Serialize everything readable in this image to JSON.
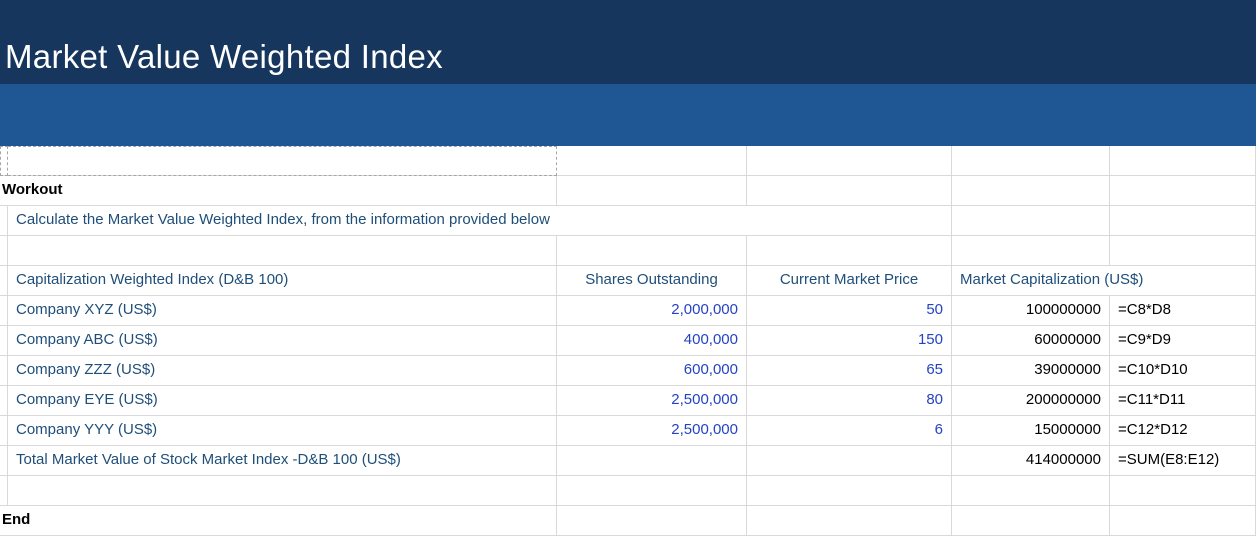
{
  "header": {
    "title": "Market Value Weighted Index"
  },
  "workout": {
    "label": "Workout",
    "instruction": "Calculate the Market Value Weighted Index, from the information provided below"
  },
  "table": {
    "col_b_header": "Capitalization Weighted Index (D&B 100)",
    "col_c_header": "Shares Outstanding",
    "col_d_header": "Current Market Price",
    "col_e_header": "Market Capitalization (US$)",
    "rows": [
      {
        "label": "Company XYZ (US$)",
        "shares": "2,000,000",
        "price": "50",
        "market_cap": "100000000",
        "formula": "=C8*D8"
      },
      {
        "label": "Company ABC (US$)",
        "shares": "400,000",
        "price": "150",
        "market_cap": "60000000",
        "formula": "=C9*D9"
      },
      {
        "label": "Company ZZZ (US$)",
        "shares": "600,000",
        "price": "65",
        "market_cap": "39000000",
        "formula": "=C10*D10"
      },
      {
        "label": "Company EYE (US$)",
        "shares": "2,500,000",
        "price": "80",
        "market_cap": "200000000",
        "formula": "=C11*D11"
      },
      {
        "label": "Company YYY (US$)",
        "shares": "2,500,000",
        "price": "6",
        "market_cap": "15000000",
        "formula": "=C12*D12"
      }
    ],
    "total": {
      "label": "Total Market Value of Stock Market Index -D&B 100 (US$)",
      "market_cap": "414000000",
      "formula": "=SUM(E8:E12)"
    }
  },
  "footer": {
    "end_label": "End"
  },
  "colors": {
    "banner_dark": "#17365D",
    "banner_light": "#1F5795",
    "label_blue": "#1F4E79",
    "value_blue": "#2443C4",
    "gridline": "#D9D9D9"
  }
}
